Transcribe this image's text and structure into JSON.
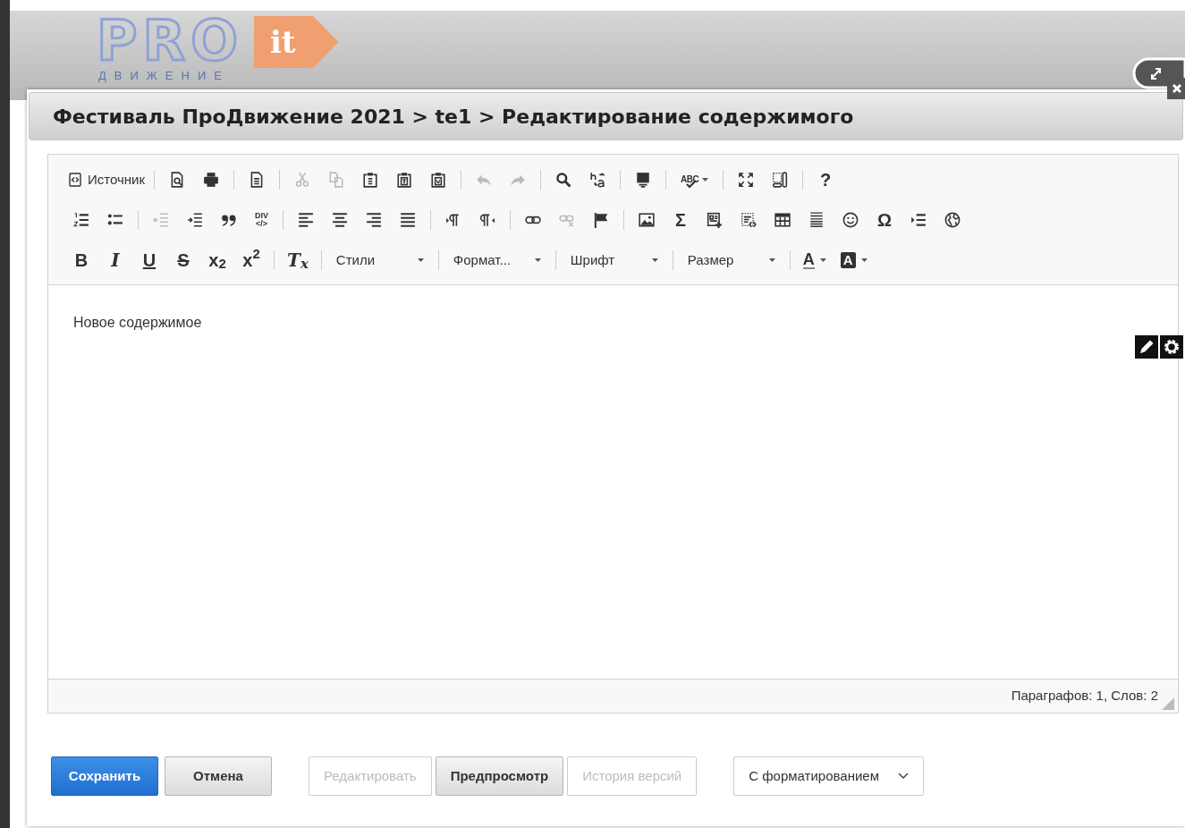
{
  "logo": {
    "word": "PRO",
    "badge": "it",
    "tagline": "ДВИЖЕНИЕ"
  },
  "dialog": {
    "title": "Фестиваль ПроДвижение 2021 > te1 > Редактирование содержимого"
  },
  "toolbar_rows": [
    [
      [
        {
          "kind": "labeled",
          "label": "Источник",
          "disabled": false
        }
      ],
      [
        {
          "kind": "icon",
          "disabled": false
        },
        {
          "kind": "icon",
          "disabled": false
        }
      ],
      [
        {
          "kind": "icon",
          "disabled": false
        }
      ],
      [
        {
          "kind": "icon",
          "disabled": true
        },
        {
          "kind": "icon",
          "disabled": true
        },
        {
          "kind": "icon",
          "disabled": false
        },
        {
          "kind": "icon",
          "disabled": false
        },
        {
          "kind": "icon",
          "disabled": false
        }
      ],
      [
        {
          "kind": "icon",
          "disabled": true
        },
        {
          "kind": "icon",
          "disabled": true
        }
      ],
      [
        {
          "kind": "icon",
          "disabled": false
        },
        {
          "kind": "icon",
          "disabled": false
        }
      ],
      [
        {
          "kind": "icon",
          "disabled": false
        }
      ],
      [
        {
          "kind": "spell",
          "glyph": "ABC",
          "disabled": false
        }
      ],
      [
        {
          "kind": "icon",
          "disabled": false
        },
        {
          "kind": "icon",
          "disabled": false
        }
      ],
      [
        {
          "kind": "glyph",
          "glyph": "?",
          "disabled": false
        }
      ]
    ],
    [
      [
        {
          "kind": "icon",
          "disabled": false
        },
        {
          "kind": "icon",
          "disabled": false
        }
      ],
      [
        {
          "kind": "icon",
          "disabled": true
        },
        {
          "kind": "icon",
          "disabled": false
        },
        {
          "kind": "icon",
          "disabled": false
        },
        {
          "kind": "div",
          "glyph": "DIV",
          "sub_glyph": "</>",
          "disabled": false
        }
      ],
      [
        {
          "kind": "icon",
          "disabled": false
        },
        {
          "kind": "icon",
          "disabled": false
        },
        {
          "kind": "icon",
          "disabled": false
        },
        {
          "kind": "icon",
          "disabled": false
        }
      ],
      [
        {
          "kind": "icon",
          "disabled": false
        },
        {
          "kind": "icon",
          "disabled": false
        }
      ],
      [
        {
          "kind": "icon",
          "disabled": false
        },
        {
          "kind": "icon",
          "disabled": true
        },
        {
          "kind": "icon",
          "disabled": false
        }
      ],
      [
        {
          "kind": "icon",
          "disabled": false
        },
        {
          "kind": "glyph",
          "glyph": "Σ",
          "disabled": false
        },
        {
          "kind": "icon",
          "disabled": false
        },
        {
          "kind": "icon",
          "disabled": false
        },
        {
          "kind": "icon",
          "disabled": false
        },
        {
          "kind": "icon",
          "disabled": false
        },
        {
          "kind": "icon",
          "disabled": false
        },
        {
          "kind": "glyph",
          "glyph": "Ω",
          "disabled": false
        },
        {
          "kind": "icon",
          "disabled": false
        },
        {
          "kind": "icon",
          "disabled": false
        }
      ]
    ],
    [
      [
        {
          "kind": "bold",
          "glyph": "B",
          "disabled": false
        },
        {
          "kind": "italic",
          "glyph": "I",
          "disabled": false
        },
        {
          "kind": "underline",
          "glyph": "U",
          "disabled": false
        },
        {
          "kind": "strike",
          "glyph": "S",
          "disabled": false
        },
        {
          "kind": "glyph",
          "glyph": "x$_{2}$",
          "disabled": false
        },
        {
          "kind": "glyph",
          "glyph": "x$^{2}$",
          "disabled": false
        }
      ],
      [
        {
          "kind": "italic",
          "glyph": "T$_{x}$",
          "disabled": false
        }
      ],
      [
        {
          "kind": "combo",
          "label": "Стили",
          "disabled": false
        }
      ],
      [
        {
          "kind": "combo",
          "label": "Формат...",
          "disabled": false
        }
      ],
      [
        {
          "kind": "combo",
          "label": "Шрифт",
          "disabled": false
        }
      ],
      [
        {
          "kind": "combo",
          "label": "Размер",
          "disabled": false
        }
      ],
      [
        {
          "kind": "textcolor",
          "glyph": "A",
          "disabled": false
        },
        {
          "kind": "bgcolor",
          "glyph": "A",
          "disabled": false
        }
      ]
    ]
  ],
  "content": "Новое содержимое",
  "status": "Параграфов: 1, Слов: 2",
  "actions": [
    {
      "label": "Сохранить",
      "kind": "primary",
      "disabled": false
    },
    {
      "label": "Отмена",
      "kind": "default",
      "disabled": false
    },
    {
      "label": "Редактировать",
      "kind": "default",
      "disabled": true
    },
    {
      "label": "Предпросмотр",
      "kind": "default",
      "disabled": false
    },
    {
      "label": "История версий",
      "kind": "default",
      "disabled": true
    }
  ],
  "mode_select": {
    "value": "С форматированием"
  }
}
